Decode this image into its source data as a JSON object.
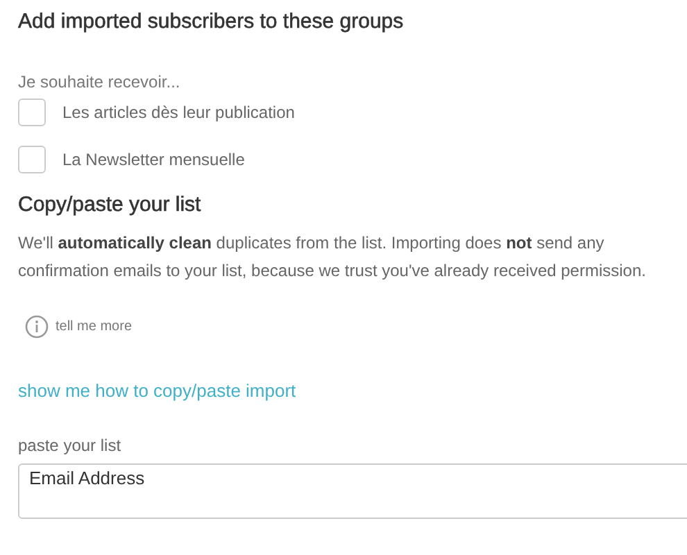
{
  "groups": {
    "title": "Add imported subscribers to these groups",
    "prompt": "Je souhaite recevoir...",
    "options": [
      {
        "label": "Les articles dès leur publication",
        "checked": false
      },
      {
        "label": "La Newsletter mensuelle",
        "checked": false
      }
    ]
  },
  "paste": {
    "title": "Copy/paste your list",
    "description": "We'll **automatically clean** duplicates from the list. Importing does **not** send any confirmation emails to your list, because we trust you've already received permission.",
    "info_link": "tell me more",
    "howto_link": "show me how to copy/paste import",
    "field_label": "paste your list",
    "field_value": "Email Address"
  }
}
